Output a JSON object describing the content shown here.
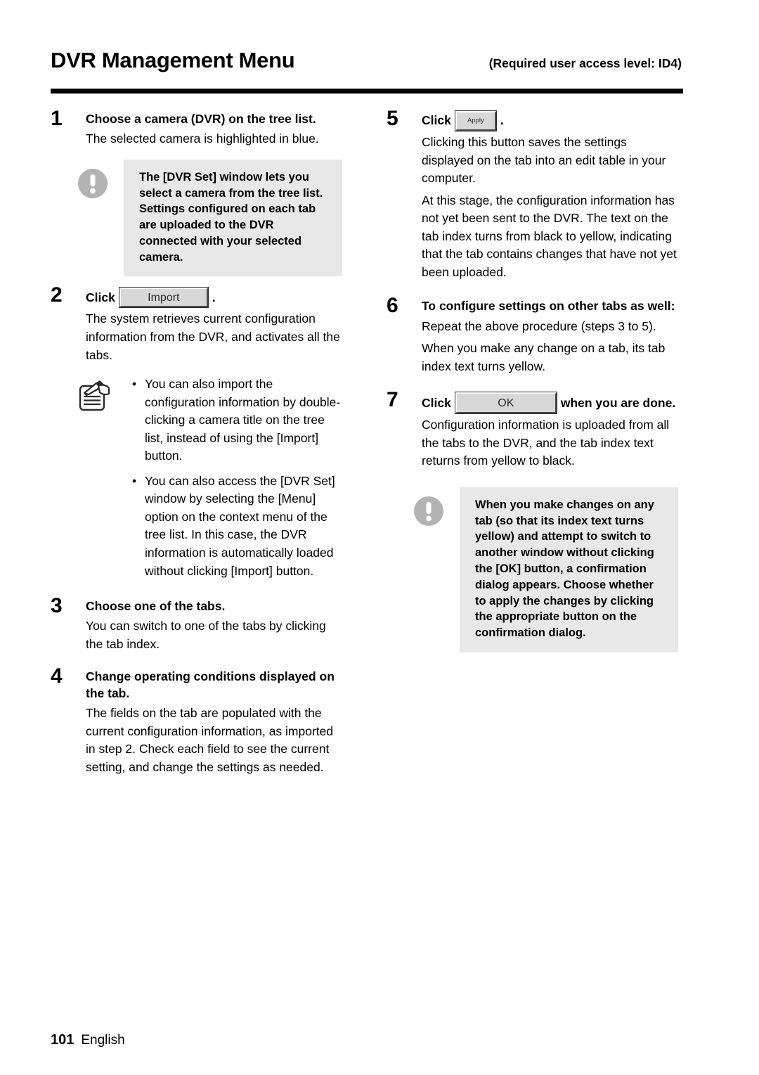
{
  "header": {
    "title": "DVR Management Menu",
    "access_level": "(Required user access level: ID4)"
  },
  "buttons": {
    "import": "Import",
    "apply": "Apply",
    "ok": "OK"
  },
  "left_column": {
    "step1": {
      "number": "1",
      "heading": "Choose a camera (DVR) on the tree list.",
      "body": "The selected camera is highlighted in blue.",
      "note": {
        "icon": "warning-exclamation-icon",
        "text": "The [DVR Set] window lets you select a camera from the tree list. Settings configured on each tab are uploaded to the DVR connected with your selected camera."
      }
    },
    "step2": {
      "number": "2",
      "heading_prefix": "Click",
      "heading_suffix": ".",
      "body": "The system retrieves current configuration information from the DVR, and activates all the tabs.",
      "tip": {
        "icon": "notepad-pencil-icon",
        "bullets": [
          "You can also import the configuration information by double-clicking a camera title on the tree list, instead of using the [Import] button.",
          "You can also access the [DVR Set] window by selecting the [Menu] option on the context menu of the tree list. In this case, the DVR information is automatically loaded without clicking [Import] button."
        ]
      }
    },
    "step3": {
      "number": "3",
      "heading": "Choose one of the tabs.",
      "body": "You can switch to one of the tabs by clicking the tab index."
    },
    "step4": {
      "number": "4",
      "heading": "Change operating conditions displayed on the tab.",
      "body": "The fields on the tab are populated with the current configuration information, as imported in step 2. Check each field to see the current setting, and change the settings as needed."
    }
  },
  "right_column": {
    "step5": {
      "number": "5",
      "heading_prefix": "Click",
      "heading_suffix": ".",
      "body1": "Clicking this button saves the settings displayed on the tab into an edit table in your computer.",
      "body2": "At this stage, the configuration information has not yet been sent to the DVR. The text on the tab index turns from black to yellow, indicating that the tab contains changes that have not yet been uploaded."
    },
    "step6": {
      "number": "6",
      "heading": "To configure settings on other tabs as well:",
      "body1": "Repeat the above procedure (steps 3 to 5).",
      "body2": "When you make any change on a tab, its tab index text turns yellow."
    },
    "step7": {
      "number": "7",
      "heading_prefix": "Click",
      "heading_suffix": "when you are done.",
      "body": "Configuration information is uploaded from all the tabs to the DVR, and the tab index text returns from yellow to black.",
      "note": {
        "icon": "warning-exclamation-icon",
        "text": "When you make changes on any tab (so that its index text turns yellow) and attempt to switch to another window without clicking the [OK] button, a confirmation dialog appears. Choose whether to apply the changes by clicking the appropriate button on the confirmation dialog."
      }
    }
  },
  "footer": {
    "page_number": "101",
    "language": "English"
  },
  "colors": {
    "note_background": "#e8e8e8",
    "icon_gray": "#b3b3b3",
    "button_face": "#d8d8d8",
    "text": "#000000"
  }
}
